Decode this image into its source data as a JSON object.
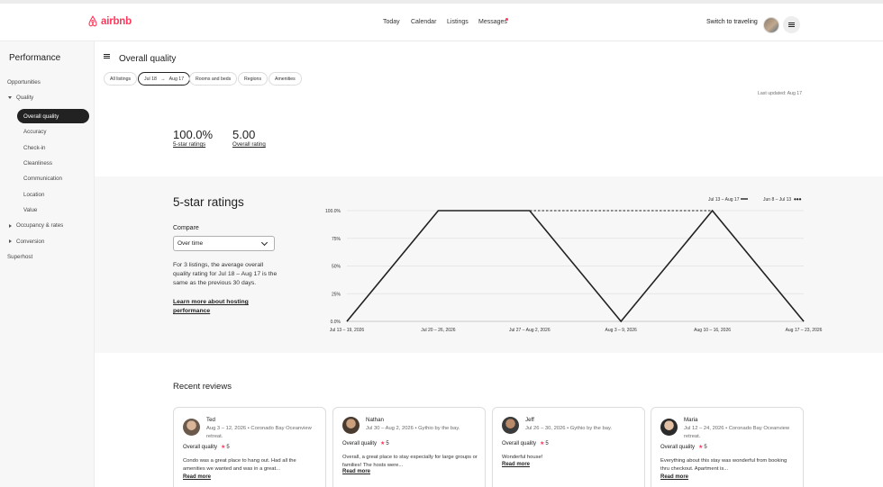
{
  "topbar": {
    "brand": "airbnb",
    "brand_color": "#ff385c",
    "nav": [
      "Today",
      "Calendar",
      "Listings",
      "Messages"
    ],
    "switch_label": "Switch to traveling",
    "icons": [
      "airbnb-logo-icon",
      "menu-icon",
      "avatar"
    ]
  },
  "sidebar": {
    "title": "Performance",
    "items": [
      {
        "label": "Opportunities"
      },
      {
        "label": "Quality"
      },
      {
        "label": "Overall quality"
      },
      {
        "label": "Accuracy"
      },
      {
        "label": "Check-in"
      },
      {
        "label": "Cleanliness"
      },
      {
        "label": "Communication"
      },
      {
        "label": "Location"
      },
      {
        "label": "Value"
      },
      {
        "label": "Occupancy & rates"
      },
      {
        "label": "Conversion"
      },
      {
        "label": "Superhost"
      }
    ]
  },
  "main": {
    "title": "Overall quality",
    "filters": {
      "all_listings": "All listings",
      "date_from": "Jul 18",
      "date_to": "Aug 17",
      "rooms": "Rooms and beds",
      "regions": "Regions",
      "amenities": "Amenities"
    },
    "last_updated": "Last updated: Aug 17",
    "stats": [
      {
        "value": "100.0%",
        "label": "5-star ratings"
      },
      {
        "value": "5.00",
        "label": "Overall rating"
      }
    ]
  },
  "ratings": {
    "title": "5-star ratings",
    "compare_label": "Compare",
    "compare_value": "Over time",
    "description": "For 3 listings, the average overall quality rating for Jul 18 – Aug 17 is the same as the previous 30 days.",
    "learn_more": "Learn more about hosting performance"
  },
  "chart_data": {
    "type": "line",
    "categories": [
      "Jul 13 – 19, 2026",
      "Jul 20 – 26, 2026",
      "Jul 27 – Aug 2, 2026",
      "Aug 3 – 9, 2026",
      "Aug 10 – 16, 2026",
      "Aug 17 – 23, 2026"
    ],
    "series": [
      {
        "name": "Jul 13 – Aug 17",
        "style": "solid",
        "values": [
          0,
          100,
          100,
          0,
          100,
          0
        ]
      },
      {
        "name": "Jun 8 – Jul 13",
        "style": "dashed",
        "values": [
          0,
          100,
          100,
          100,
          100,
          0
        ]
      }
    ],
    "y_ticks": [
      "0.0%",
      "25%",
      "50%",
      "75%",
      "100.0%"
    ],
    "ylim": [
      0,
      100
    ],
    "grid": true,
    "legend": "top-right"
  },
  "reviews": {
    "title": "Recent reviews",
    "items": [
      {
        "name": "Ted",
        "meta": "Aug 3 – 12, 2026 • Coronado Bay Oceanview retreat.",
        "rating_label": "Overall quality",
        "score": "5",
        "text": "Condo was a great place to hang out. Had all the amenities we wanted and was in a great...",
        "more": "Read more"
      },
      {
        "name": "Nathan",
        "meta": "Jul 30 – Aug 2, 2026 • Gythio by the bay.",
        "rating_label": "Overall quality",
        "score": "5",
        "text": "Overall, a great place to stay especially for large groups or families! The hosts were...",
        "more": "Read more"
      },
      {
        "name": "Jeff",
        "meta": "Jul 26 – 30, 2026 • Gythio by the bay.",
        "rating_label": "Overall quality",
        "score": "5",
        "text": "Wonderful house!",
        "more": "Read more"
      },
      {
        "name": "Maria",
        "meta": "Jul 12 – 24, 2026 • Coronado Bay Oceanview retreat.",
        "rating_label": "Overall quality",
        "score": "5",
        "text": "Everything about this stay was wonderful from booking thru checkout. Apartment is...",
        "more": "Read more"
      }
    ]
  }
}
